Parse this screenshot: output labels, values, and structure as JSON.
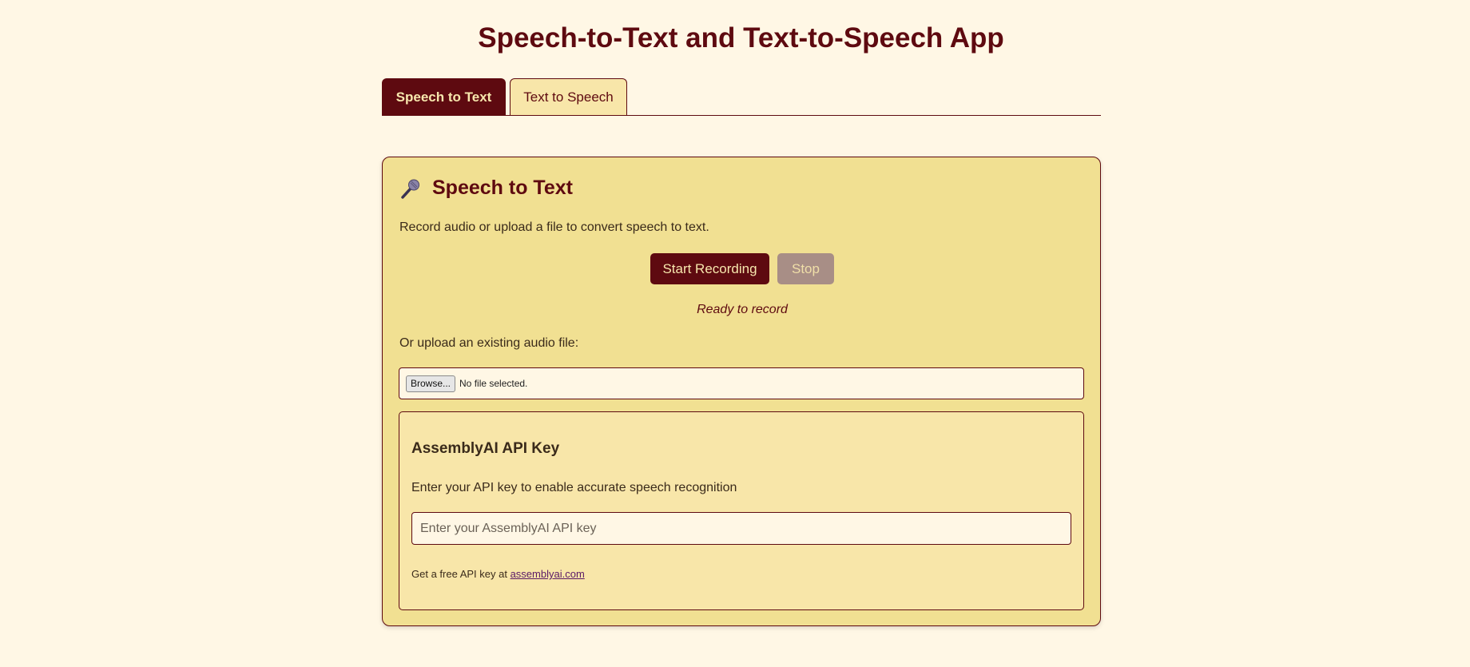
{
  "app": {
    "title": "Speech-to-Text and Text-to-Speech App"
  },
  "tabs": [
    {
      "label": "Speech to Text",
      "active": true
    },
    {
      "label": "Text to Speech",
      "active": false
    }
  ],
  "panel": {
    "icon": "microphone-icon",
    "heading": "Speech to Text",
    "description": "Record audio or upload a file to convert speech to text.",
    "start_button": "Start Recording",
    "stop_button": "Stop",
    "status": "Ready to record",
    "upload_label": "Or upload an existing audio file:",
    "file_input": {
      "browse_label": "Browse...",
      "status": "No file selected."
    },
    "api": {
      "title": "AssemblyAI API Key",
      "description": "Enter your API key to enable accurate speech recognition",
      "input_value": "",
      "input_placeholder": "Enter your AssemblyAI API key",
      "note_prefix": "Get a free API key at",
      "link_text": "assemblyai.com"
    }
  },
  "colors": {
    "background": "#fff7e5",
    "primary": "#5e0a10",
    "panel": "#f1e092",
    "inner_box": "#f8e6a9",
    "disabled_button": "#a88e86"
  }
}
